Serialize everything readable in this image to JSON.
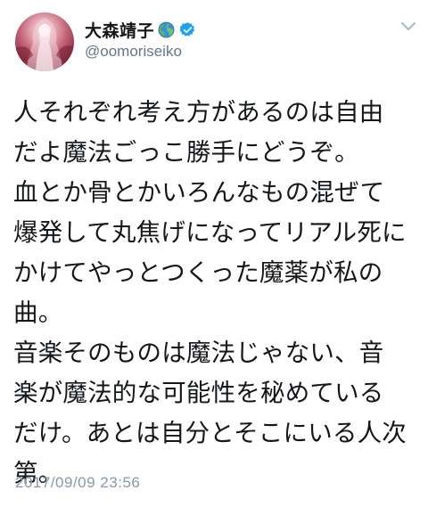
{
  "tweet": {
    "author": {
      "display_name": "大森靖子",
      "handle": "@oomoriseiko",
      "name_emoji_icon": "globe-earth-icon",
      "verified_icon": "verified-badge-icon",
      "avatar_icon": "profile-avatar"
    },
    "menu_icon": "chevron-down-icon",
    "text_lines": [
      "人それぞれ考え方があるのは自由",
      "だよ魔法ごっこ勝手にどうぞ。",
      "血とか骨とかいろんなもの混ぜて",
      "爆発して丸焦げになってリアル死に",
      "かけてやっとつくった魔薬が私の",
      "曲。",
      "音楽そのものは魔法じゃない、音",
      "楽が魔法的な可能性を秘めている",
      "だけ。あとは自分とそこにいる人次",
      "第。"
    ],
    "timestamp": "2017/09/09 23:56"
  },
  "colors": {
    "text": "#14171a",
    "secondary_text": "#657786",
    "timestamp_text": "#8899a6",
    "verified_blue": "#1da1f2",
    "chevron_gray": "#aab8c2"
  }
}
